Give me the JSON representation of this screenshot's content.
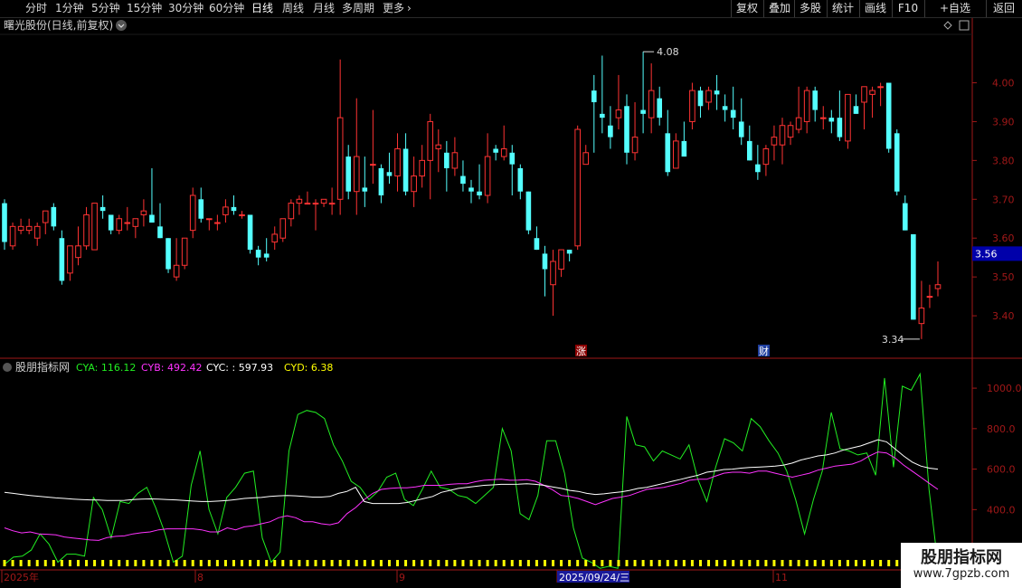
{
  "toolbar": {
    "periods": [
      "分时",
      "1分钟",
      "5分钟",
      "15分钟",
      "30分钟",
      "60分钟",
      "日线",
      "周线",
      "月线",
      "多周期",
      "更多"
    ],
    "active_period": "日线",
    "more_chevron_icon": "chevron-right-icon",
    "right_buttons": [
      "复权",
      "叠加",
      "多股",
      "统计",
      "画线",
      "F10",
      "+自选",
      "返回"
    ]
  },
  "price_panel": {
    "title": "曙光股份(日线,前复权)",
    "menu_icon": "chevron-down-icon",
    "right_icons": [
      "diamond-icon",
      "panel-toggle-icon"
    ],
    "high_label": "4.08",
    "low_label": "3.34",
    "current_price": "3.56",
    "marker_zhang": "涨",
    "marker_cai": "财"
  },
  "indicator_panel": {
    "title": "股朋指标网",
    "cya_label": "CYA: 116.12",
    "cyb_label": "CYB: 492.42",
    "cyc_label": "CYC: : 597.93",
    "cyd_label": "CYD: 6.38"
  },
  "date_axis": {
    "labels": [
      "2025年",
      "8",
      "9",
      "2025/09/24/三",
      "11"
    ]
  },
  "watermark": {
    "title": "股朋指标网",
    "url": "www.7gpzb.com"
  },
  "colors": {
    "up": "#ff3333",
    "down": "#54ffff",
    "axis": "#a01818",
    "cya": "#22ee22",
    "cyb": "#ff33ff",
    "cyc": "#ffffff",
    "cyd": "#ffff00",
    "current_price_bg": "#0000aa"
  },
  "chart_data": [
    {
      "type": "candlestick",
      "title": "曙光股份(日线,前复权)",
      "ylim": [
        3.3,
        4.12
      ],
      "y_ticks": [
        3.4,
        3.5,
        3.6,
        3.7,
        3.8,
        3.9,
        4.0
      ],
      "ohlc": [
        [
          3.69,
          3.7,
          3.57,
          3.59
        ],
        [
          3.58,
          3.64,
          3.57,
          3.63
        ],
        [
          3.62,
          3.65,
          3.61,
          3.63
        ],
        [
          3.62,
          3.65,
          3.61,
          3.63
        ],
        [
          3.6,
          3.64,
          3.58,
          3.63
        ],
        [
          3.64,
          3.67,
          3.61,
          3.67
        ],
        [
          3.68,
          3.69,
          3.62,
          3.63
        ],
        [
          3.6,
          3.62,
          3.48,
          3.49
        ],
        [
          3.51,
          3.58,
          3.49,
          3.58
        ],
        [
          3.55,
          3.63,
          3.53,
          3.58
        ],
        [
          3.58,
          3.68,
          3.57,
          3.66
        ],
        [
          3.57,
          3.69,
          3.57,
          3.69
        ],
        [
          3.68,
          3.71,
          3.65,
          3.67
        ],
        [
          3.66,
          3.66,
          3.61,
          3.62
        ],
        [
          3.62,
          3.66,
          3.61,
          3.65
        ],
        [
          3.64,
          3.68,
          3.62,
          3.64
        ],
        [
          3.63,
          3.65,
          3.6,
          3.65
        ],
        [
          3.66,
          3.7,
          3.63,
          3.67
        ],
        [
          3.66,
          3.78,
          3.64,
          3.64
        ],
        [
          3.63,
          3.69,
          3.6,
          3.6
        ],
        [
          3.6,
          3.6,
          3.51,
          3.52
        ],
        [
          3.5,
          3.6,
          3.49,
          3.53
        ],
        [
          3.53,
          3.6,
          3.52,
          3.6
        ],
        [
          3.62,
          3.73,
          3.6,
          3.71
        ],
        [
          3.7,
          3.73,
          3.64,
          3.65
        ],
        [
          3.65,
          3.65,
          3.62,
          3.65
        ],
        [
          3.64,
          3.66,
          3.62,
          3.64
        ],
        [
          3.66,
          3.7,
          3.64,
          3.68
        ],
        [
          3.68,
          3.71,
          3.66,
          3.67
        ],
        [
          3.66,
          3.67,
          3.65,
          3.66
        ],
        [
          3.66,
          3.66,
          3.56,
          3.57
        ],
        [
          3.57,
          3.58,
          3.53,
          3.55
        ],
        [
          3.56,
          3.6,
          3.54,
          3.55
        ],
        [
          3.59,
          3.63,
          3.57,
          3.61
        ],
        [
          3.6,
          3.65,
          3.59,
          3.65
        ],
        [
          3.65,
          3.7,
          3.63,
          3.69
        ],
        [
          3.69,
          3.71,
          3.66,
          3.7
        ],
        [
          3.69,
          3.72,
          3.69,
          3.69
        ],
        [
          3.69,
          3.7,
          3.62,
          3.69
        ],
        [
          3.69,
          3.7,
          3.68,
          3.7
        ],
        [
          3.69,
          3.73,
          3.66,
          3.69
        ],
        [
          3.7,
          4.06,
          3.66,
          3.91
        ],
        [
          3.81,
          3.84,
          3.7,
          3.72
        ],
        [
          3.72,
          3.96,
          3.66,
          3.81
        ],
        [
          3.73,
          3.81,
          3.68,
          3.72
        ],
        [
          3.79,
          3.93,
          3.74,
          3.79
        ],
        [
          3.78,
          3.79,
          3.69,
          3.71
        ],
        [
          3.77,
          3.82,
          3.74,
          3.76
        ],
        [
          3.76,
          3.87,
          3.72,
          3.83
        ],
        [
          3.83,
          3.87,
          3.71,
          3.72
        ],
        [
          3.72,
          3.81,
          3.68,
          3.76
        ],
        [
          3.76,
          3.84,
          3.73,
          3.8
        ],
        [
          3.8,
          3.92,
          3.7,
          3.9
        ],
        [
          3.83,
          3.88,
          3.77,
          3.84
        ],
        [
          3.82,
          3.85,
          3.72,
          3.78
        ],
        [
          3.78,
          3.86,
          3.76,
          3.82
        ],
        [
          3.76,
          3.8,
          3.72,
          3.74
        ],
        [
          3.73,
          3.75,
          3.69,
          3.72
        ],
        [
          3.72,
          3.79,
          3.7,
          3.71
        ],
        [
          3.71,
          3.87,
          3.69,
          3.81
        ],
        [
          3.83,
          3.84,
          3.8,
          3.82
        ],
        [
          3.81,
          3.89,
          3.8,
          3.83
        ],
        [
          3.82,
          3.84,
          3.71,
          3.79
        ],
        [
          3.78,
          3.79,
          3.7,
          3.72
        ],
        [
          3.72,
          3.72,
          3.61,
          3.62
        ],
        [
          3.6,
          3.63,
          3.57,
          3.57
        ],
        [
          3.56,
          3.58,
          3.45,
          3.52
        ],
        [
          3.48,
          3.57,
          3.4,
          3.54
        ],
        [
          3.52,
          3.57,
          3.5,
          3.57
        ],
        [
          3.57,
          3.57,
          3.54,
          3.56
        ],
        [
          3.58,
          3.89,
          3.57,
          3.88
        ],
        [
          3.79,
          3.84,
          3.79,
          3.82
        ],
        [
          3.98,
          4.02,
          3.82,
          3.95
        ],
        [
          3.92,
          4.07,
          3.87,
          3.91
        ],
        [
          3.89,
          3.94,
          3.83,
          3.86
        ],
        [
          3.91,
          4.02,
          3.88,
          3.93
        ],
        [
          3.94,
          3.97,
          3.79,
          3.82
        ],
        [
          3.82,
          3.95,
          3.8,
          3.86
        ],
        [
          3.93,
          4.08,
          3.87,
          3.92
        ],
        [
          3.91,
          4.05,
          3.87,
          3.98
        ],
        [
          3.96,
          3.99,
          3.89,
          3.91
        ],
        [
          3.87,
          3.93,
          3.76,
          3.77
        ],
        [
          3.78,
          3.87,
          3.79,
          3.85
        ],
        [
          3.85,
          3.9,
          3.81,
          3.81
        ],
        [
          3.9,
          4.0,
          3.88,
          3.98
        ],
        [
          3.98,
          3.99,
          3.91,
          3.94
        ],
        [
          3.95,
          3.99,
          3.93,
          3.98
        ],
        [
          3.98,
          4.02,
          3.93,
          3.97
        ],
        [
          3.94,
          3.97,
          3.9,
          3.93
        ],
        [
          3.93,
          3.99,
          3.88,
          3.91
        ],
        [
          3.9,
          3.96,
          3.84,
          3.86
        ],
        [
          3.85,
          3.89,
          3.8,
          3.8
        ],
        [
          3.79,
          3.84,
          3.75,
          3.77
        ],
        [
          3.79,
          3.84,
          3.76,
          3.83
        ],
        [
          3.84,
          3.89,
          3.8,
          3.86
        ],
        [
          3.84,
          3.91,
          3.79,
          3.89
        ],
        [
          3.86,
          3.9,
          3.84,
          3.89
        ],
        [
          3.88,
          3.99,
          3.87,
          3.91
        ],
        [
          3.9,
          3.99,
          3.87,
          3.98
        ],
        [
          3.98,
          3.99,
          3.9,
          3.93
        ],
        [
          3.91,
          3.94,
          3.88,
          3.91
        ],
        [
          3.91,
          3.93,
          3.87,
          3.9
        ],
        [
          3.91,
          3.98,
          3.85,
          3.86
        ],
        [
          3.85,
          3.96,
          3.83,
          3.97
        ],
        [
          3.94,
          3.97,
          3.92,
          3.92
        ],
        [
          3.95,
          3.99,
          3.88,
          3.99
        ],
        [
          3.97,
          3.99,
          3.91,
          3.98
        ],
        [
          3.99,
          4.0,
          3.94,
          3.99
        ],
        [
          4.0,
          4.0,
          3.82,
          3.83
        ],
        [
          3.87,
          3.88,
          3.71,
          3.72
        ],
        [
          3.69,
          3.71,
          3.62,
          3.62
        ],
        [
          3.61,
          3.61,
          3.39,
          3.39
        ],
        [
          3.38,
          3.49,
          3.34,
          3.42
        ],
        [
          3.45,
          3.48,
          3.42,
          3.45
        ],
        [
          3.47,
          3.54,
          3.45,
          3.48
        ]
      ]
    },
    {
      "type": "line",
      "title": "股朋指标网",
      "ylim": [
        120,
        1130
      ],
      "y_ticks": [
        200,
        400,
        600,
        800,
        1000
      ],
      "series": [
        {
          "name": "CYA",
          "values": [
            130,
            165,
            170,
            200,
            280,
            230,
            140,
            180,
            180,
            170,
            460,
            400,
            260,
            440,
            430,
            480,
            510,
            410,
            290,
            140,
            170,
            520,
            690,
            400,
            280,
            460,
            510,
            580,
            590,
            260,
            140,
            190,
            690,
            870,
            890,
            880,
            850,
            720,
            640,
            540,
            510,
            450,
            490,
            560,
            580,
            450,
            420,
            500,
            590,
            510,
            500,
            470,
            460,
            430,
            470,
            510,
            800,
            690,
            380,
            350,
            470,
            740,
            740,
            580,
            310,
            160,
            140,
            110,
            120,
            110,
            860,
            720,
            710,
            640,
            690,
            670,
            650,
            720,
            550,
            440,
            610,
            750,
            730,
            690,
            850,
            810,
            740,
            680,
            590,
            450,
            280,
            450,
            590,
            880,
            700,
            690,
            670,
            680,
            570,
            1050,
            610,
            1010,
            990,
            1070,
            500,
            130
          ]
        },
        {
          "name": "CYB",
          "values": [
            310,
            295,
            285,
            290,
            280,
            278,
            275,
            265,
            260,
            255,
            250,
            248,
            262,
            268,
            270,
            280,
            286,
            290,
            300,
            305,
            305,
            305,
            305,
            300,
            290,
            290,
            310,
            300,
            315,
            320,
            330,
            340,
            360,
            370,
            360,
            340,
            340,
            330,
            325,
            335,
            380,
            410,
            450,
            480,
            500,
            505,
            508,
            508,
            512,
            520,
            520,
            520,
            525,
            528,
            528,
            538,
            545,
            548,
            550,
            545,
            546,
            548,
            540,
            520,
            498,
            470,
            465,
            455,
            440,
            425,
            440,
            455,
            462,
            470,
            485,
            500,
            505,
            510,
            520,
            530,
            545,
            550,
            550,
            565,
            580,
            585,
            585,
            580,
            590,
            590,
            580,
            570,
            560,
            570,
            580,
            595,
            605,
            615,
            620,
            625,
            640,
            665,
            685,
            680,
            655,
            620,
            590,
            560,
            530,
            500
          ]
        },
        {
          "name": "CYC",
          "values": [
            485,
            480,
            475,
            470,
            466,
            462,
            458,
            455,
            452,
            450,
            448,
            447,
            445,
            445,
            446,
            450,
            452,
            453,
            452,
            450,
            448,
            445,
            442,
            440,
            440,
            442,
            445,
            450,
            455,
            458,
            460,
            465,
            468,
            470,
            468,
            465,
            462,
            462,
            465,
            480,
            490,
            510,
            440,
            430,
            430,
            430,
            430,
            435,
            445,
            455,
            465,
            485,
            495,
            505,
            510,
            515,
            520,
            522,
            525,
            525,
            526,
            528,
            525,
            520,
            512,
            505,
            495,
            490,
            480,
            475,
            478,
            483,
            488,
            495,
            505,
            510,
            520,
            530,
            540,
            550,
            560,
            570,
            585,
            590,
            598,
            600,
            605,
            608,
            610,
            612,
            615,
            620,
            630,
            645,
            655,
            665,
            670,
            680,
            695,
            705,
            715,
            730,
            745,
            735,
            700,
            665,
            635,
            615,
            605,
            600
          ]
        },
        {
          "name": "CYD",
          "values": [
            6.38
          ]
        }
      ]
    }
  ]
}
